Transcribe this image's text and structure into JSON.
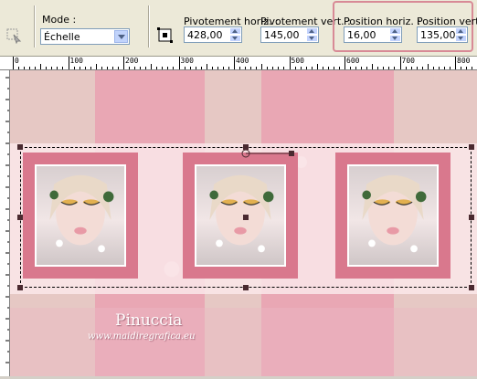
{
  "toolbar": {
    "mode_label": "Mode :",
    "mode_value": "Échelle",
    "pivot_h_label": "Pivotement horiz. :",
    "pivot_h_value": "428,00",
    "pivot_v_label": "Pivotement vert. :",
    "pivot_v_value": "145,00",
    "pos_h_label": "Position horiz. :",
    "pos_h_value": "16,00",
    "pos_v_label": "Position vert. :",
    "pos_v_value": "135,00"
  },
  "ruler": {
    "labels": [
      "0",
      "100",
      "200",
      "300",
      "400",
      "500",
      "600",
      "700",
      "800"
    ]
  },
  "watermark": {
    "name": "Pinuccia",
    "url": "www.maidiregrafica.eu"
  },
  "colors": {
    "highlight_box": "#d88a96",
    "frame": "#d9788d",
    "background": "#e6c8c4"
  }
}
